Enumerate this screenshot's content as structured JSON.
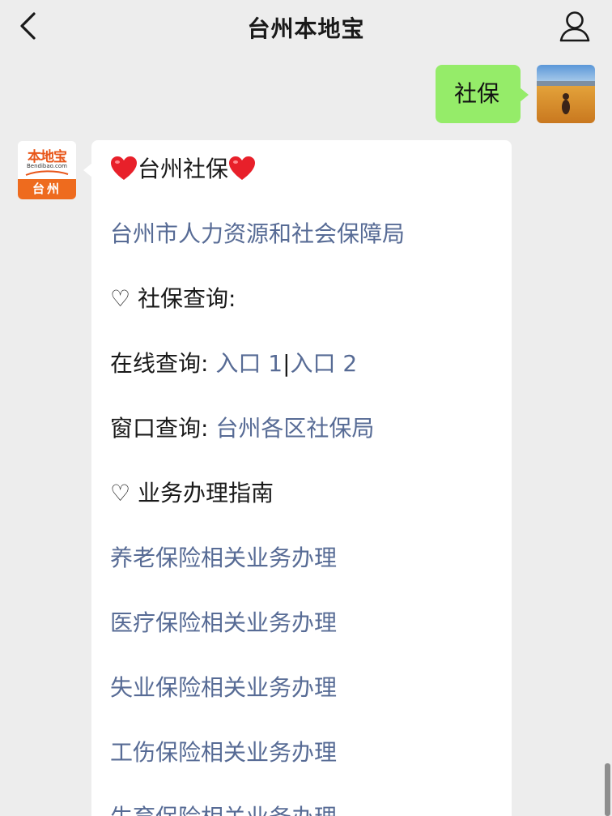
{
  "header": {
    "title": "台州本地宝"
  },
  "outgoing": {
    "text": "社保"
  },
  "incoming_avatar": {
    "brand": "本地宝",
    "domain": "Bendibao.com",
    "city": "台州"
  },
  "incoming": {
    "title_heart": "❤",
    "title": "台州社保",
    "org_link": "台州市人力资源和社会保障局",
    "section1": {
      "heart": "♡",
      "label": "社保查询:"
    },
    "online_query": {
      "label": "在线查询:",
      "link1": "入口 1",
      "separator": "|",
      "link2": "入口 2"
    },
    "window_query": {
      "label": "窗口查询:",
      "link": "台州各区社保局"
    },
    "section2": {
      "heart": "♡",
      "label": "业务办理指南"
    },
    "guides": [
      "养老保险相关业务办理",
      "医疗保险相关业务办理",
      "失业保险相关业务办理",
      "工伤保险相关业务办理",
      "生育保险相关业务办理"
    ]
  },
  "colors": {
    "background": "#ededed",
    "link": "#576b95",
    "outgoing_bubble": "#95ec69",
    "heart_red": "#e8202a",
    "brand_orange": "#ee6b1e"
  }
}
